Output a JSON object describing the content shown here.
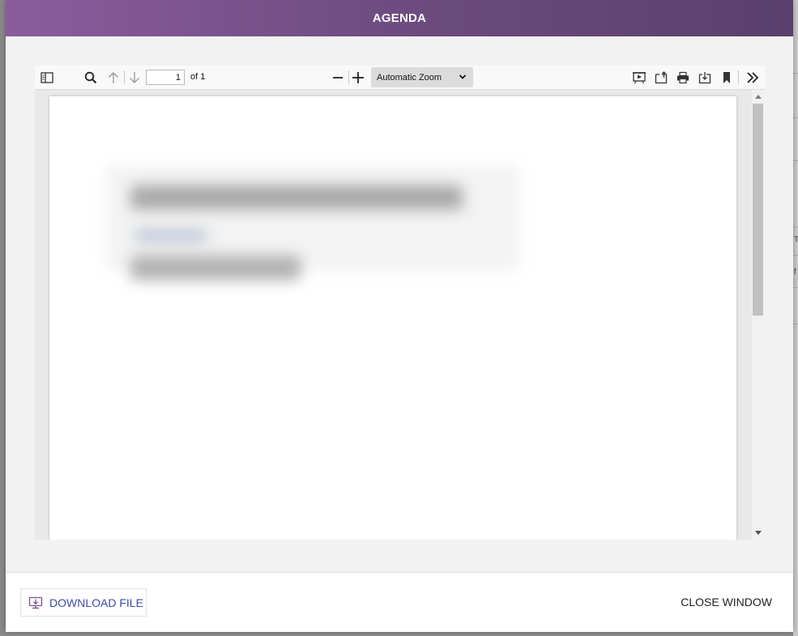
{
  "modal": {
    "title": "AGENDA"
  },
  "viewer": {
    "toolbar": {
      "sidebar_toggle_icon": "sidebar-toggle-icon",
      "search_icon": "search-icon",
      "prev_icon": "arrow-up-icon",
      "next_icon": "arrow-down-icon",
      "page_number": "1",
      "page_count": "of 1",
      "zoom_out_icon": "minus-icon",
      "zoom_in_icon": "plus-icon",
      "zoom_selected": "Automatic Zoom",
      "presentation_icon": "presentation-mode-icon",
      "open_icon": "open-file-icon",
      "print_icon": "print-icon",
      "download_icon": "download-icon",
      "bookmark_icon": "bookmark-icon",
      "tools_icon": "double-chevron-right-icon"
    }
  },
  "footer": {
    "download_label": "DOWNLOAD FILE",
    "close_label": "CLOSE WINDOW"
  },
  "background": {
    "edge_chars": [
      "T",
      "f"
    ]
  },
  "colors": {
    "header_start": "#8a5c9c",
    "header_end": "#5b3f6c",
    "link_blue": "#3d4b9e",
    "download_icon_purple": "#7d4f8e"
  }
}
